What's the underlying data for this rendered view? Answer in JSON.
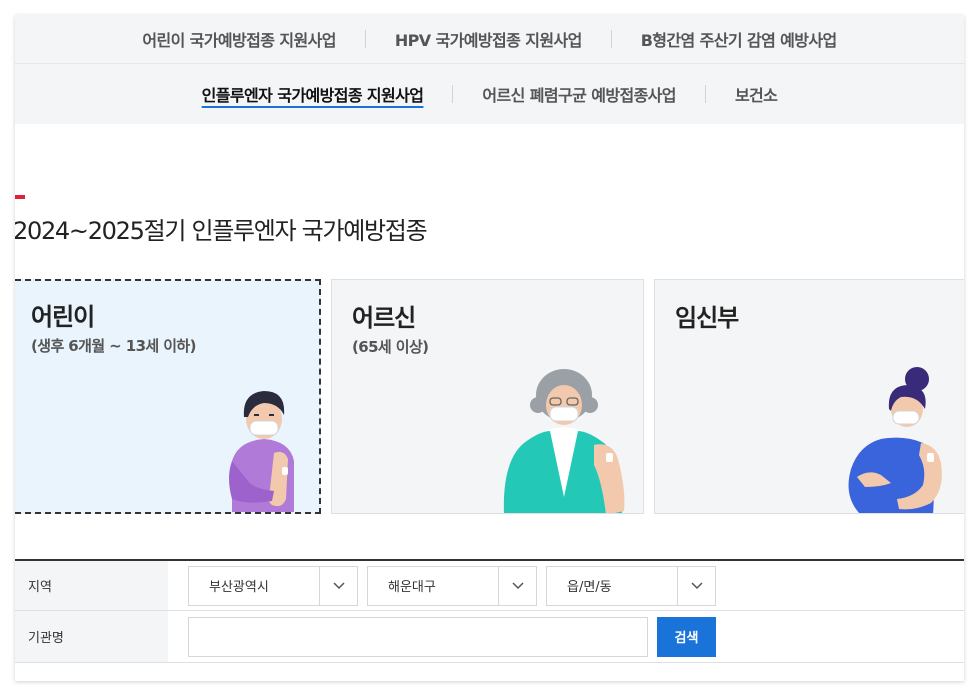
{
  "nav": {
    "row1": [
      "어린이 국가예방접종 지원사업",
      "HPV 국가예방접종 지원사업",
      "B형간염 주산기 감염 예방사업"
    ],
    "row2": [
      "인플루엔자 국가예방접종 지원사업",
      "어르신 폐렴구균 예방접종사업",
      "보건소"
    ],
    "active": "인플루엔자 국가예방접종 지원사업"
  },
  "section": {
    "title": "2024~2025절기 인플루엔자 국가예방접종"
  },
  "cards": [
    {
      "title": "어린이",
      "sub": "(생후 6개월 ~ 13세 이하)",
      "selected": true
    },
    {
      "title": "어르신",
      "sub": "(65세 이상)",
      "selected": false
    },
    {
      "title": "임신부",
      "sub": "",
      "selected": false
    }
  ],
  "form": {
    "region_label": "지역",
    "region_selects": [
      "부산광역시",
      "해운대구",
      "읍/면/동"
    ],
    "org_label": "기관명",
    "org_value": "",
    "search_label": "검색"
  },
  "colors": {
    "accent": "#1a73d9",
    "mark": "#e0203c",
    "selected_bg": "#eaf4fd"
  },
  "icons": {
    "select_arrow": "chevron-down-icon"
  }
}
